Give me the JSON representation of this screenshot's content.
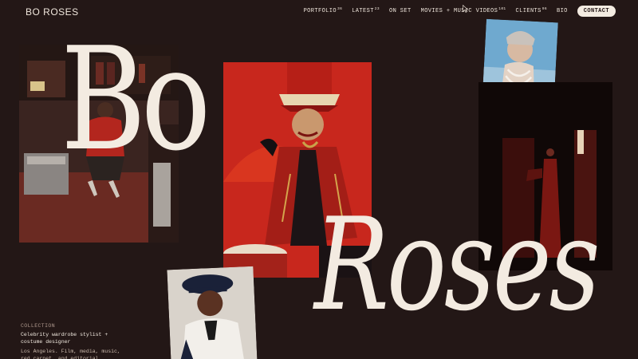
{
  "header": {
    "logo": "BO ROSES",
    "nav": [
      {
        "label": "PORTFOLIO",
        "count": "36"
      },
      {
        "label": "LATEST",
        "count": "23"
      },
      {
        "label": "ON SET",
        "count": ""
      },
      {
        "label": "MOVIES + MUSIC VIDEOS",
        "count": "101"
      },
      {
        "label": "CLIENTS",
        "count": "96"
      },
      {
        "label": "BIO",
        "count": ""
      }
    ],
    "contact_label": "CONTACT"
  },
  "hero": {
    "word_top": "Bo",
    "word_bottom": "Roses"
  },
  "caption": {
    "label": "COLLECTION",
    "title": "Celebrity wardrobe stylist + costume designer",
    "description": "Los Angeles. Film, media, music, red carpet, and editorial"
  },
  "colors": {
    "background": "#231716",
    "text": "#efe6dc",
    "accent_red": "#c8271d"
  },
  "icons": {
    "cursor": "mouse-pointer-icon"
  }
}
